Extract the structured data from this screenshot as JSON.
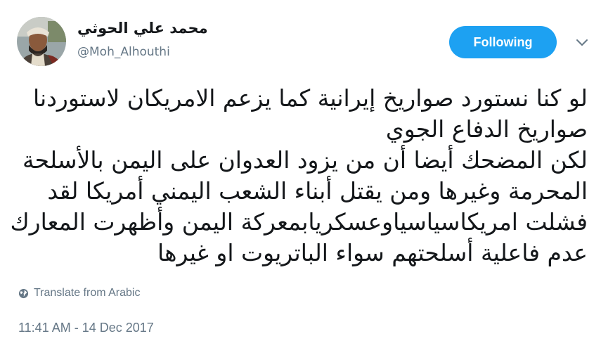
{
  "user": {
    "display_name": "محمد علي الحوثي",
    "handle": "@Moh_Alhouthi"
  },
  "follow_button_label": "Following",
  "tweet": {
    "lines": [
      "لو كنا نستورد صواريخ إيرانية كما يزعم الامريكان لاستوردنا",
      "صواريخ الدفاع الجوي",
      "لكن المضحك أيضا أن من يزود العدوان على اليمن بالأسلحة",
      "المحرمة وغيرها ومن يقتل أبناء الشعب اليمني أمريكا لقد",
      "فشلت امريكاسياسياوعسكريابمعركة اليمن وأظهرت المعارك",
      "عدم فاعلية أسلحتهم سواء الباتريوت او غيرها"
    ]
  },
  "translate_label": "Translate from Arabic",
  "timestamp": "11:41 AM - 14 Dec 2017",
  "colors": {
    "accent": "#1da1f2",
    "text": "#14171a",
    "muted": "#657786"
  },
  "icons": {
    "caret": "chevron-down-icon",
    "translate": "globe-icon"
  }
}
